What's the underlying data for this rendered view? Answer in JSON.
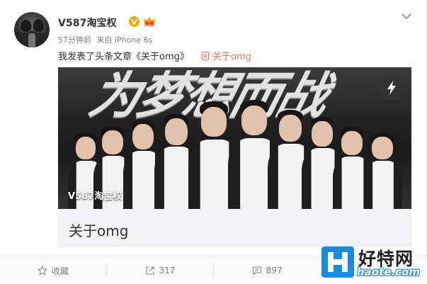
{
  "post": {
    "author": "V587淘宝权",
    "time": "57分钟前",
    "source": "来自 iPhone 6s",
    "text": "我发表了头条文章《关于omg》",
    "article_link": "关于omg"
  },
  "card": {
    "cover_title": "为梦想而战",
    "cover_author": "V587淘宝权",
    "title": "关于omg"
  },
  "actions": {
    "favorite_label": "收藏",
    "repost_count": "317",
    "comment_count": "897"
  },
  "watermark": {
    "name": "好特网",
    "url": "haote.com"
  },
  "colors": {
    "link": "#eb7350",
    "vip": "#f7a800",
    "watermark_blue": "#1a8ae0"
  },
  "icons": [
    "chevron-down-icon",
    "vip-icon",
    "crown-icon",
    "document-icon",
    "flash-icon",
    "star-icon",
    "repost-icon",
    "comment-icon"
  ]
}
